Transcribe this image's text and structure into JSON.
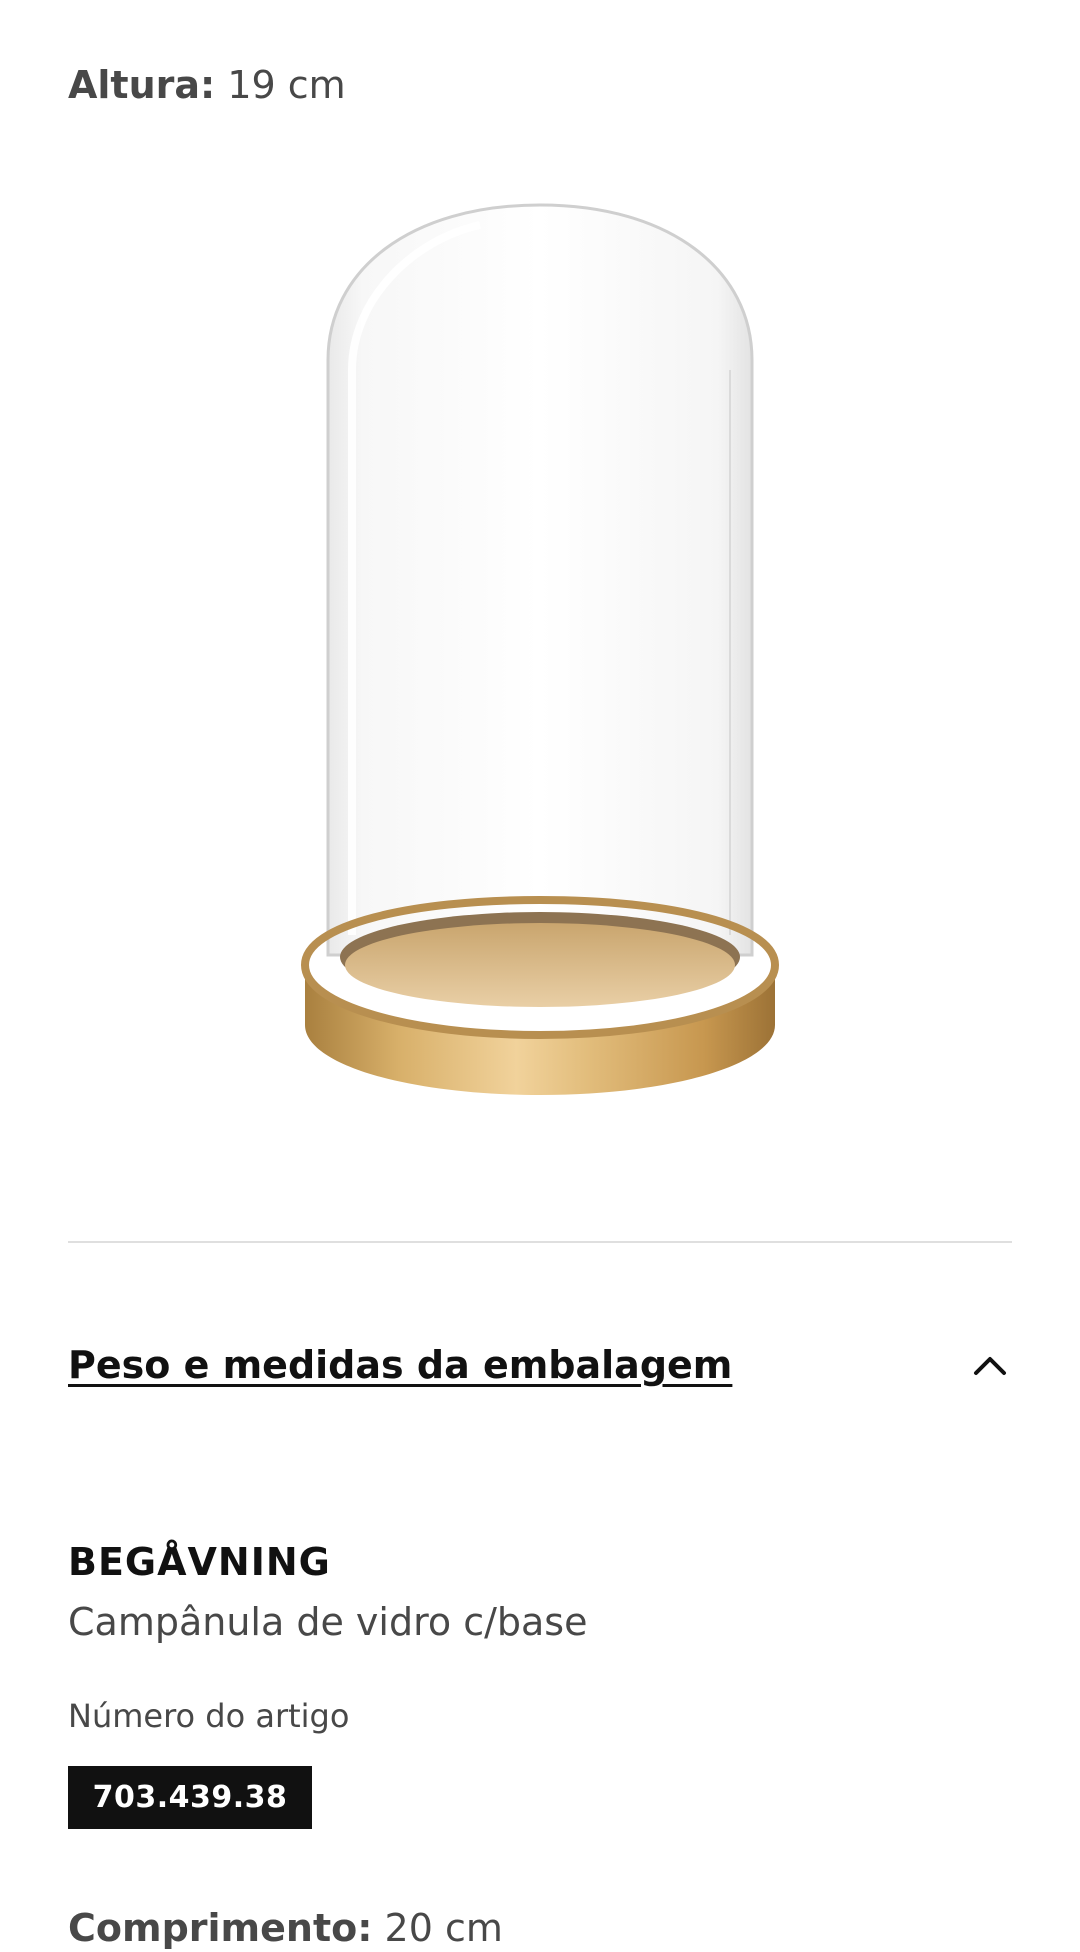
{
  "specs": {
    "height": {
      "label": "Altura:",
      "value": "19 cm"
    },
    "length": {
      "label": "Comprimento:",
      "value": "20 cm"
    }
  },
  "product_image": {
    "alt_subject": "glass-dome-with-gold-base"
  },
  "accordion": {
    "title": "Peso e medidas da embalagem",
    "state": "expanded",
    "icon": "chevron-up-icon"
  },
  "product": {
    "name": "BEGÅVNING",
    "description": "Campânula de vidro c/base",
    "article_label": "Número do artigo",
    "article_number": "703.439.38"
  },
  "colors": {
    "text_primary": "#111111",
    "text_secondary": "#484848",
    "divider": "#dfdfdf",
    "badge_bg": "#111111",
    "badge_text": "#ffffff"
  }
}
